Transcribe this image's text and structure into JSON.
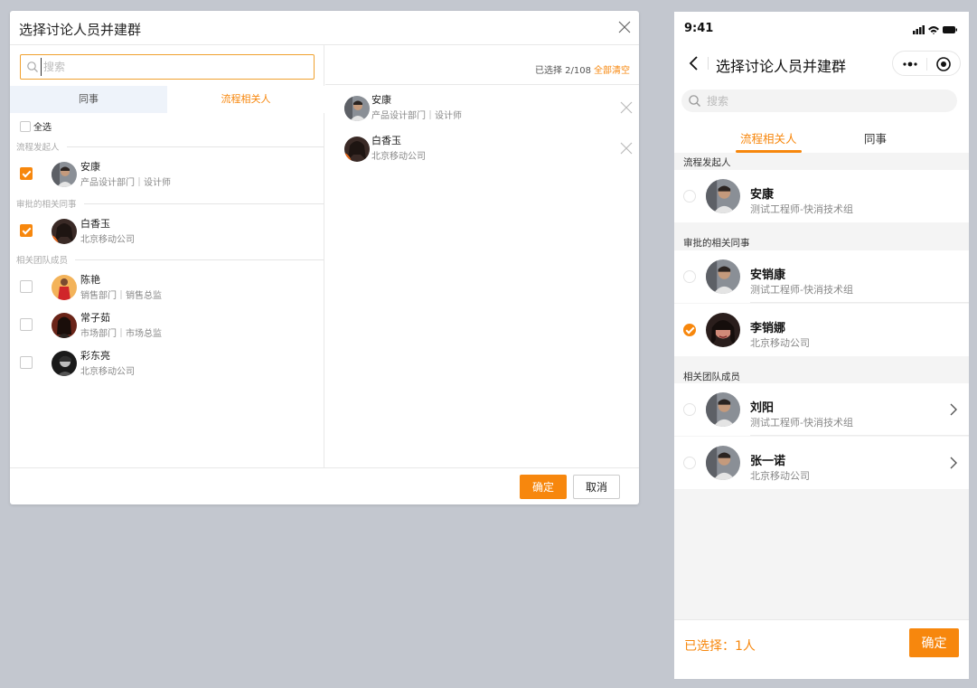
{
  "colors": {
    "accent": "#f7870d",
    "tab_bg": "#eef3fa",
    "page_bg": "#c3c7cf"
  },
  "dialog": {
    "title": "选择讨论人员并建群",
    "search": {
      "placeholder": "搜索",
      "value": ""
    },
    "tabs": [
      {
        "label": "同事",
        "active": false
      },
      {
        "label": "流程相关人",
        "active": true
      }
    ],
    "select_all": "全选",
    "sections": [
      {
        "title": "流程发起人",
        "people": [
          {
            "name": "安康",
            "sub": "产品设计部门｜设计师",
            "checked": true
          }
        ]
      },
      {
        "title": "审批的相关同事",
        "people": [
          {
            "name": "白香玉",
            "sub": "北京移动公司",
            "checked": true
          }
        ]
      },
      {
        "title": "相关团队成员",
        "people": [
          {
            "name": "陈艳",
            "sub": "销售部门｜销售总监",
            "checked": false
          },
          {
            "name": "常子茹",
            "sub": "市场部门｜市场总监",
            "checked": false
          },
          {
            "name": "彩东亮",
            "sub": "北京移动公司",
            "checked": false
          }
        ]
      }
    ],
    "selected_count": "已选择  2/108",
    "clear_all": "全部清空",
    "selected": [
      {
        "name": "安康",
        "sub": "产品设计部门｜设计师"
      },
      {
        "name": "白香玉",
        "sub": "北京移动公司"
      }
    ],
    "ok_label": "确定",
    "cancel_label": "取消"
  },
  "mobile": {
    "time": "9:41",
    "title": "选择讨论人员并建群",
    "search_placeholder": "搜索",
    "tabs": [
      {
        "label": "流程相关人",
        "active": true
      },
      {
        "label": "同事",
        "active": false
      }
    ],
    "sections": [
      {
        "title": "流程发起人",
        "people": [
          {
            "name": "安康",
            "sub": "测试工程师-快消技术组",
            "checked": false
          }
        ]
      },
      {
        "title": "审批的相关同事",
        "people": [
          {
            "name": "安销康",
            "sub": "测试工程师-快消技术组",
            "checked": false
          },
          {
            "name": "李销娜",
            "sub": "北京移动公司",
            "checked": true
          }
        ]
      },
      {
        "title": "相关团队成员",
        "people": [
          {
            "name": "刘阳",
            "sub": "测试工程师-快消技术组",
            "checked": false
          },
          {
            "name": "张一诺",
            "sub": "北京移动公司",
            "checked": false
          }
        ]
      }
    ],
    "selected_count": "已选择：1人",
    "ok_label": "确定"
  }
}
